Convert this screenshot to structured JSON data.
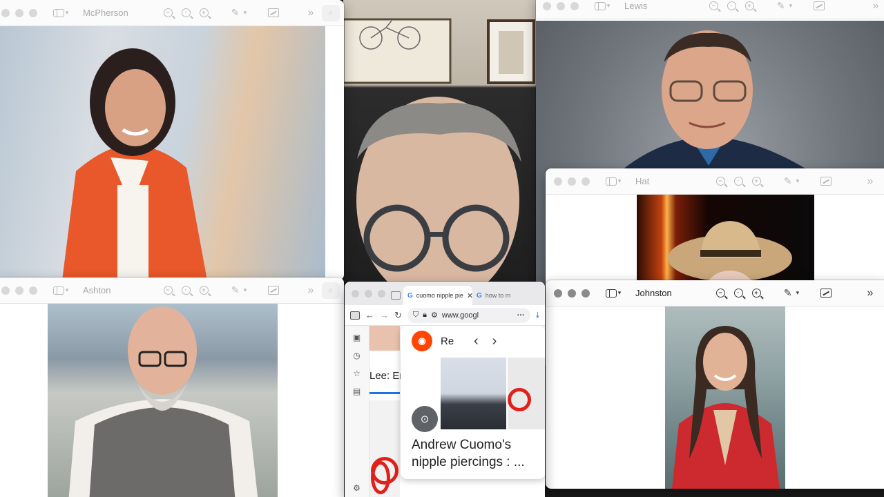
{
  "windows": {
    "mcpherson": {
      "title": "McPherson"
    },
    "lewis": {
      "title": "Lewis"
    },
    "hat": {
      "title": "Hat"
    },
    "ashton": {
      "title": "Ashton"
    },
    "johnston": {
      "title": "Johnston"
    }
  },
  "browser": {
    "tabs": [
      {
        "label": "cuomo nipple pie",
        "favicon": "G"
      },
      {
        "label": "how to m",
        "favicon": "G"
      }
    ],
    "url": "www.googl",
    "result": {
      "source_partial": "Re",
      "title": "Andrew Cuomo's nipple piercings : ..."
    },
    "side_text": "Lee: Er"
  },
  "colors": {
    "toolbar_bg": "#fbfbfb",
    "inactive_icon": "#b9b9b9",
    "active_icon": "#3a3a3a",
    "reddit_orange": "#ff4500",
    "google_blue": "#1a73e8",
    "accent_red": "#e0201b"
  }
}
